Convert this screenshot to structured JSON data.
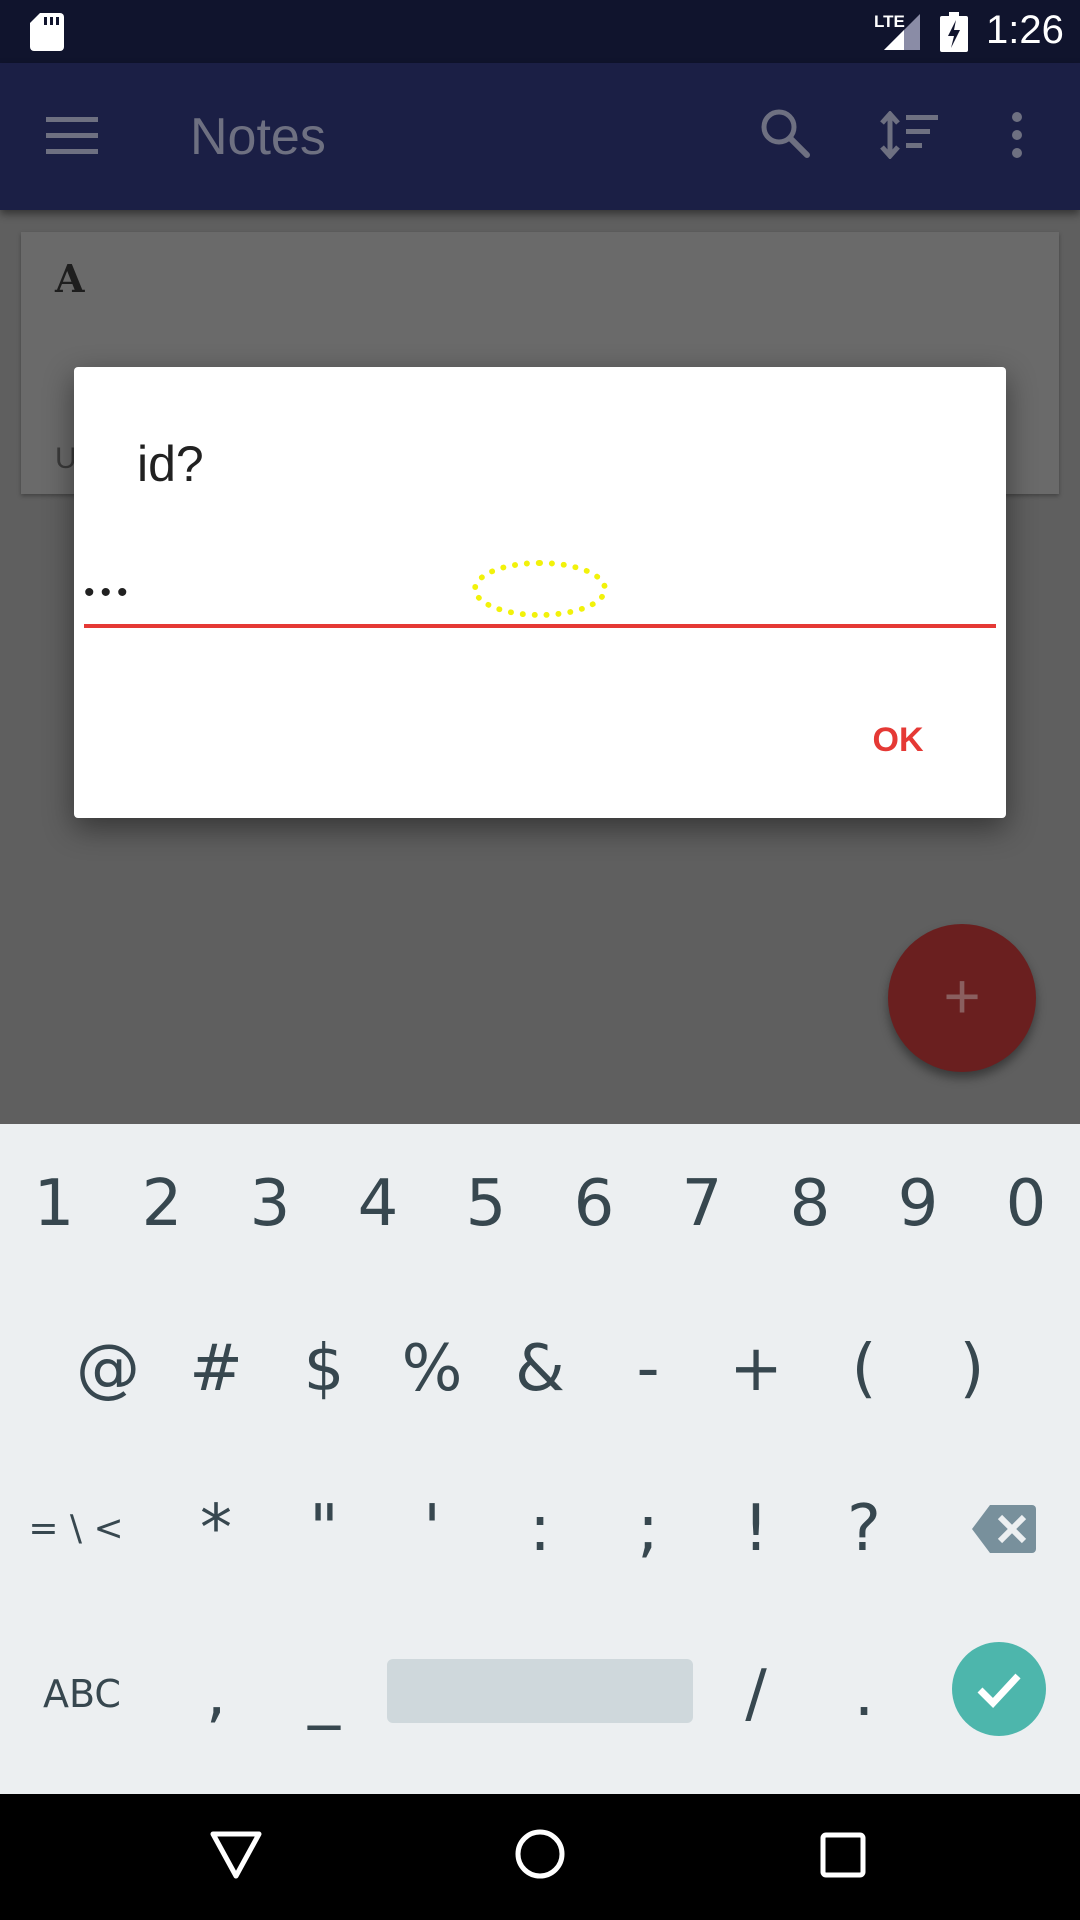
{
  "status_bar": {
    "time": "1:26",
    "network": "LTE",
    "icons": [
      "sd-card-icon",
      "signal-icon",
      "battery-charging-icon"
    ]
  },
  "app_bar": {
    "title": "Notes",
    "icons": [
      "menu-icon",
      "search-icon",
      "sort-icon",
      "more-vert-icon"
    ]
  },
  "note": {
    "title": "A",
    "subtitle": "U"
  },
  "dialog": {
    "title": "id?",
    "input_value": "•••",
    "ok_label": "OK"
  },
  "fab": {
    "icon": "add-icon",
    "glyph": "+"
  },
  "keyboard": {
    "row1": [
      "1",
      "2",
      "3",
      "4",
      "5",
      "6",
      "7",
      "8",
      "9",
      "0"
    ],
    "row2": [
      "@",
      "#",
      "$",
      "%",
      "&",
      "-",
      "+",
      "(",
      ")"
    ],
    "row3": [
      "= \\ <",
      "*",
      "\"",
      "'",
      ":",
      ";",
      "!",
      "?"
    ],
    "row4": [
      "ABC",
      ",",
      "_",
      "/",
      "."
    ],
    "backspace_icon": "backspace-icon",
    "enter_icon": "check-icon"
  },
  "nav_bar": {
    "icons": [
      "back-icon",
      "home-icon",
      "recents-icon"
    ]
  },
  "colors": {
    "accent": "#e53935",
    "status_bar": "#10142d",
    "app_bar_dimmed": "#1b1f45",
    "keyboard_bg": "#eceff1",
    "enter_key": "#4db6ac",
    "fab_dimmed": "#6a1f1f",
    "touch_marker": "#f2f20a"
  }
}
